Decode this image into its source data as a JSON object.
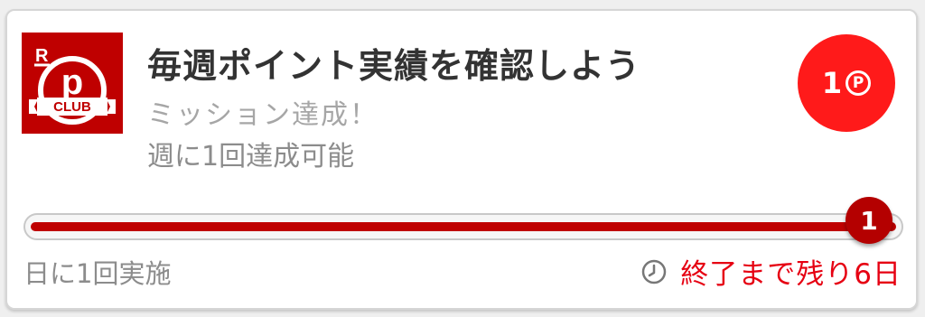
{
  "mission": {
    "title": "毎週ポイント実績を確認しよう",
    "subtitle": "ミッション達成！",
    "frequency": "週に1回達成可能",
    "logo_icon": "rakuten-point-club-logo",
    "logo_text": "CLUB",
    "logo_letter": "R"
  },
  "points": {
    "value": "1",
    "icon": "point-icon",
    "icon_glyph": "P"
  },
  "progress": {
    "current": "1",
    "fraction": 1.0
  },
  "footer": {
    "daily_limit": "日に1回実施",
    "remaining": "終了まで残り6日",
    "clock_icon": "clock-icon"
  },
  "colors": {
    "brand_red": "#bf0000",
    "badge_red": "#ff1a1a",
    "alert_red": "#e60012",
    "title_text": "#333333",
    "muted_text": "#a6a6a6"
  }
}
